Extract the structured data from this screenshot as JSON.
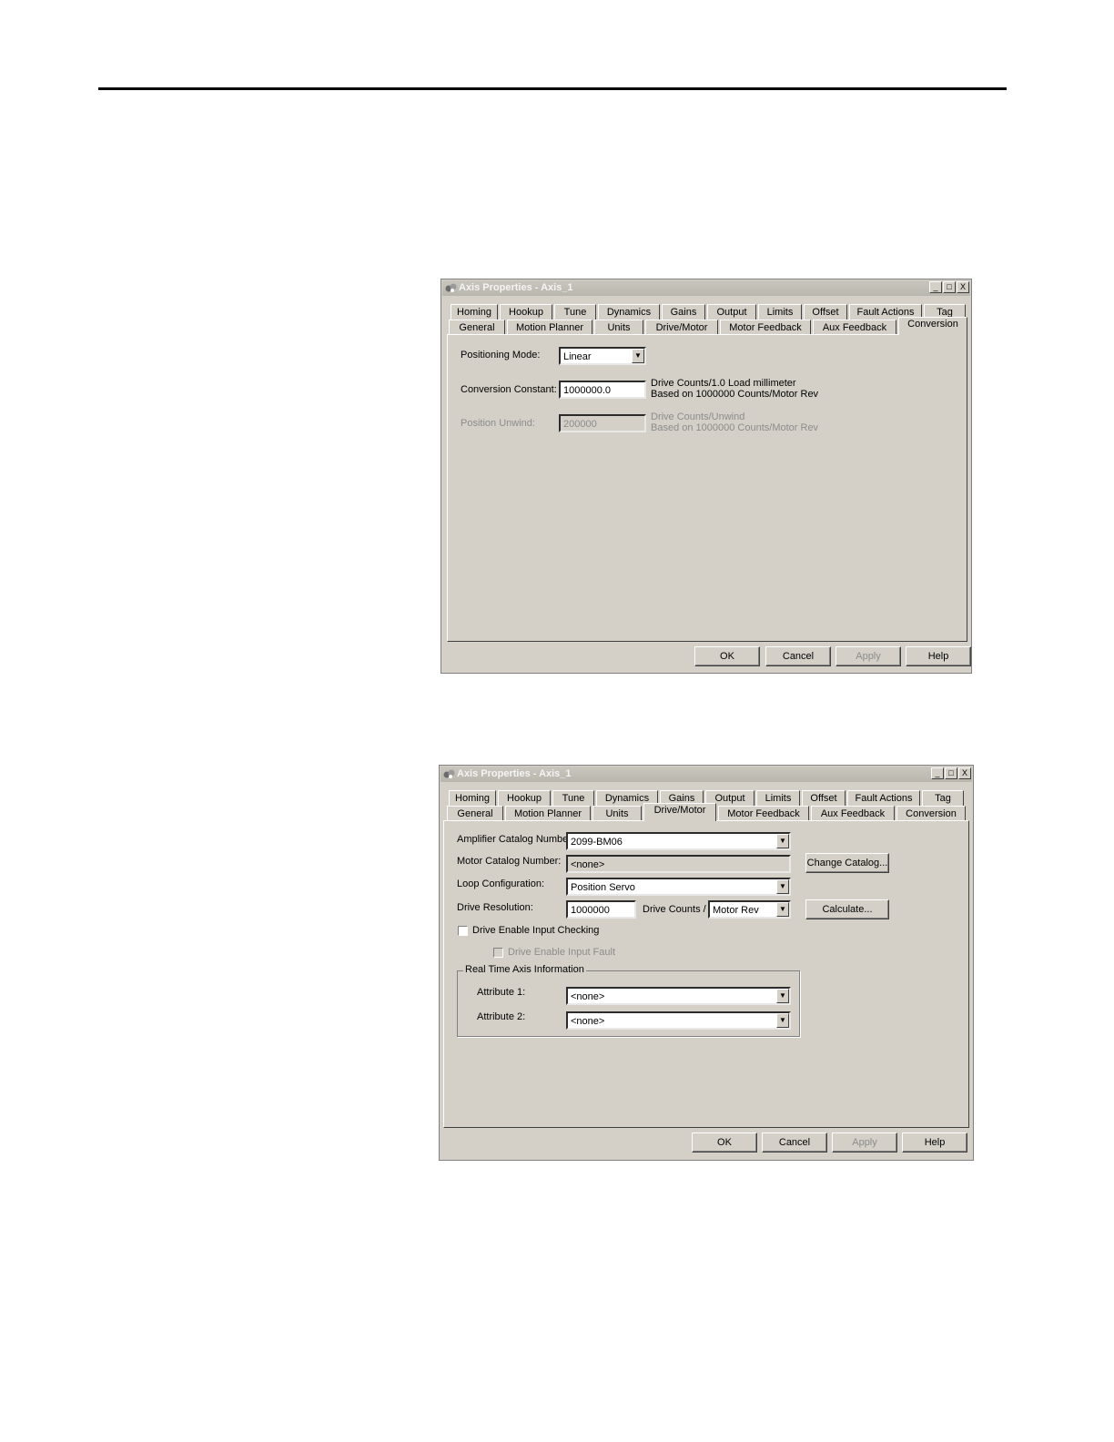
{
  "dialog1": {
    "title": "Axis Properties - Axis_1",
    "window_buttons": {
      "minimize": "_",
      "maximize": "□",
      "close": "X"
    },
    "tabs_row1": [
      "Homing",
      "Hookup",
      "Tune",
      "Dynamics",
      "Gains",
      "Output",
      "Limits",
      "Offset",
      "Fault Actions",
      "Tag"
    ],
    "tabs_row2": [
      "General",
      "Motion Planner",
      "Units",
      "Drive/Motor",
      "Motor Feedback",
      "Aux Feedback",
      "Conversion"
    ],
    "active_tab": "Conversion",
    "positioning_mode_label": "Positioning Mode:",
    "positioning_mode_value": "Linear",
    "conversion_constant_label": "Conversion Constant:",
    "conversion_constant_value": "1000000.0",
    "conversion_constant_unit1": "Drive Counts/1.0 Load millimeter",
    "conversion_constant_unit2": "Based on 1000000 Counts/Motor Rev",
    "position_unwind_label": "Position Unwind:",
    "position_unwind_value": "200000",
    "position_unwind_unit1": "Drive Counts/Unwind",
    "position_unwind_unit2": "Based on 1000000 Counts/Motor Rev",
    "buttons": {
      "ok": "OK",
      "cancel": "Cancel",
      "apply": "Apply",
      "help": "Help"
    }
  },
  "dialog2": {
    "title": "Axis Properties - Axis_1",
    "window_buttons": {
      "minimize": "_",
      "maximize": "□",
      "close": "X"
    },
    "tabs_row1": [
      "Homing",
      "Hookup",
      "Tune",
      "Dynamics",
      "Gains",
      "Output",
      "Limits",
      "Offset",
      "Fault Actions",
      "Tag"
    ],
    "tabs_row2": [
      "General",
      "Motion Planner",
      "Units",
      "Drive/Motor",
      "Motor Feedback",
      "Aux Feedback",
      "Conversion"
    ],
    "active_tab": "Drive/Motor",
    "amplifier_label": "Amplifier Catalog Number:",
    "amplifier_value": "2099-BM06",
    "motor_label": "Motor Catalog Number:",
    "motor_value": "<none>",
    "change_catalog_button": "Change Catalog...",
    "loop_label": "Loop Configuration:",
    "loop_value": "Position Servo",
    "drive_resolution_label": "Drive Resolution:",
    "drive_resolution_value": "1000000",
    "drive_counts_label": "Drive Counts /",
    "drive_counts_unit": "Motor Rev",
    "calculate_button": "Calculate...",
    "drive_enable_checking_label": "Drive Enable Input Checking",
    "drive_enable_fault_label": "Drive Enable Input Fault",
    "realtime_group_label": "Real Time Axis Information",
    "attribute1_label": "Attribute 1:",
    "attribute1_value": "<none>",
    "attribute2_label": "Attribute 2:",
    "attribute2_value": "<none>",
    "buttons": {
      "ok": "OK",
      "cancel": "Cancel",
      "apply": "Apply",
      "help": "Help"
    }
  }
}
